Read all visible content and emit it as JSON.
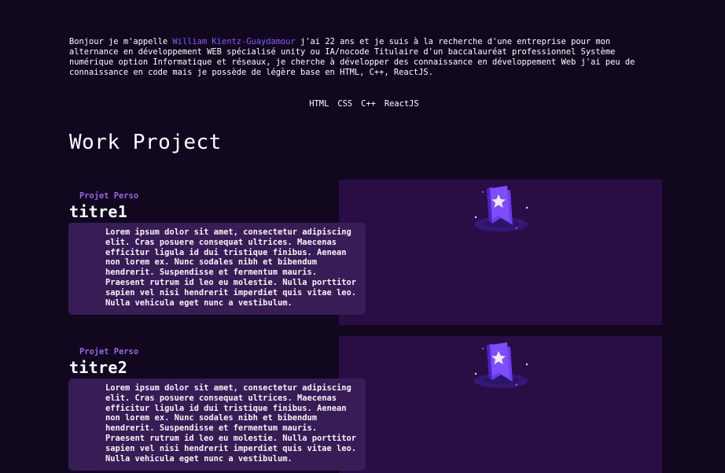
{
  "intro": {
    "before_name": "Bonjour je m'appelle ",
    "name": "William Kientz-Guaydamour",
    "after_name": " j'ai 22 ans et je suis à la recherche d'une entreprise pour mon alternance en développement WEB spécialisé unity ou IA/nocode Titulaire d'un baccalauréat professionnel Système numérique option Informatique et réseaux, je cherche à développer des connaissance en développement Web j'ai peu de connaissance en code mais je possède de légère base en HTML, C++, ReactJS."
  },
  "skills": [
    "HTML",
    "CSS",
    "C++",
    "ReactJS"
  ],
  "section": {
    "title": "Work Project"
  },
  "projects": [
    {
      "kicker": "Projet Perso",
      "title": "titre1",
      "description": "Lorem ipsum dolor sit amet, consectetur adipiscing elit. Cras posuere consequat ultrices. Maecenas efficitur ligula id dui tristique finibus. Aenean non lorem ex. Nunc sodales nibh et bibendum hendrerit. Suspendisse et fermentum mauris. Praesent rutrum id leo eu molestie. Nulla porttitor sapien vel nisi hendrerit imperdiet quis vitae leo. Nulla vehicula eget nunc a vestibulum.",
      "image_icon": "star-badge-icon"
    },
    {
      "kicker": "Projet Perso",
      "title": "titre2",
      "description": "Lorem ipsum dolor sit amet, consectetur adipiscing elit. Cras posuere consequat ultrices. Maecenas efficitur ligula id dui tristique finibus. Aenean non lorem ex. Nunc sodales nibh et bibendum hendrerit. Suspendisse et fermentum mauris. Praesent rutrum id leo eu molestie. Nulla porttitor sapien vel nisi hendrerit imperdiet quis vitae leo. Nulla vehicula eget nunc a vestibulum.",
      "image_icon": "star-badge-icon"
    }
  ],
  "colors": {
    "background": "#11071f",
    "accent": "#8a5cf6",
    "kicker": "#9a67ea",
    "image_panel": "#2a0d45",
    "card": "#3a1d58"
  }
}
